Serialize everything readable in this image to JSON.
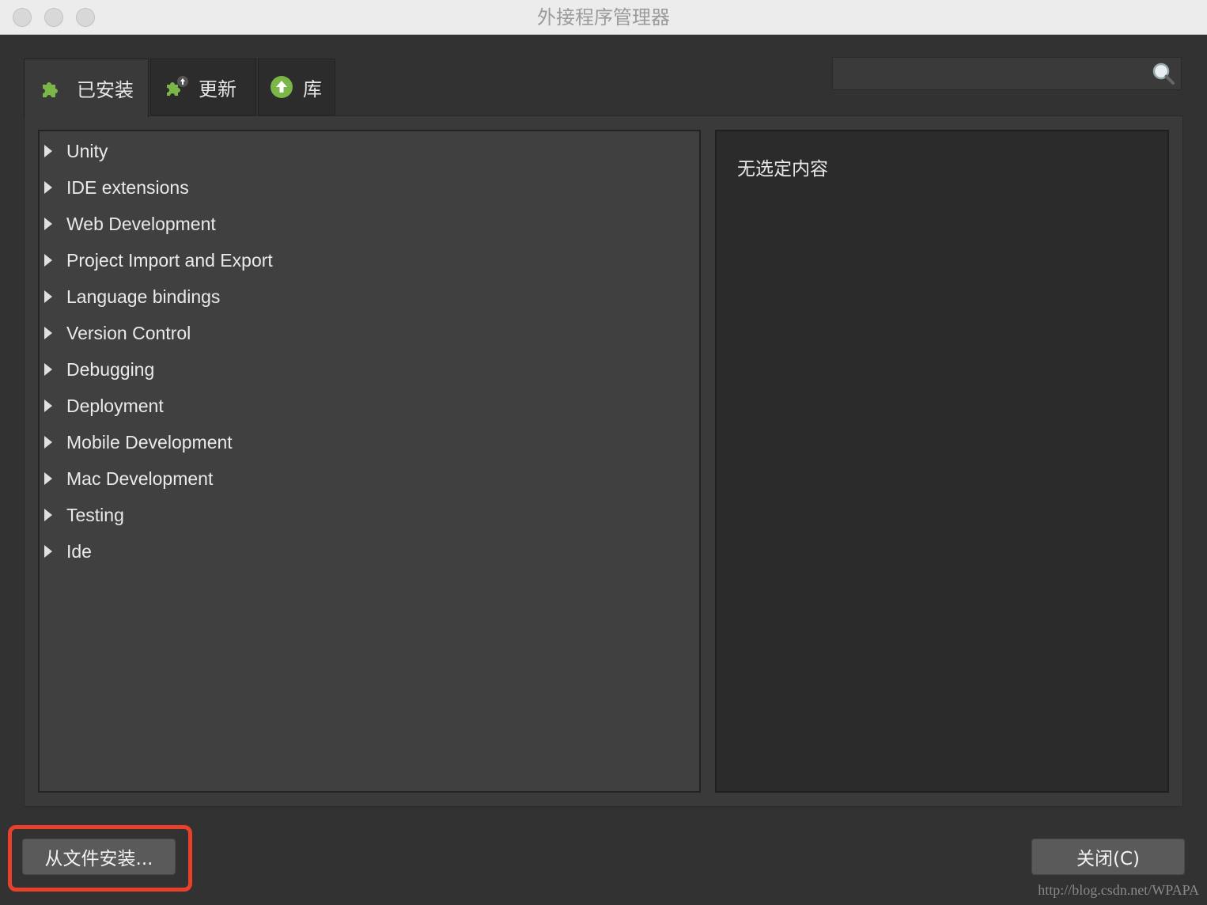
{
  "window": {
    "title": "外接程序管理器"
  },
  "tabs": [
    {
      "label": "已安装",
      "icon": "puzzle-icon",
      "active": true
    },
    {
      "label": "更新",
      "icon": "puzzle-update-icon",
      "active": false
    },
    {
      "label": "库",
      "icon": "gallery-upload-icon",
      "active": false
    }
  ],
  "search": {
    "value": "",
    "placeholder": ""
  },
  "tree": {
    "items": [
      {
        "label": "Unity"
      },
      {
        "label": "IDE extensions"
      },
      {
        "label": "Web Development"
      },
      {
        "label": "Project Import and Export"
      },
      {
        "label": "Language bindings"
      },
      {
        "label": "Version Control"
      },
      {
        "label": "Debugging"
      },
      {
        "label": "Deployment"
      },
      {
        "label": "Mobile Development"
      },
      {
        "label": "Mac Development"
      },
      {
        "label": "Testing"
      },
      {
        "label": "Ide"
      }
    ]
  },
  "detail": {
    "empty_text": "无选定内容"
  },
  "buttons": {
    "install_from_file": "从文件安装...",
    "close": "关闭(C)"
  },
  "watermark": "http://blog.csdn.net/WPAPA",
  "colors": {
    "accent_green": "#7ab648",
    "highlight_red": "#e8402a"
  }
}
